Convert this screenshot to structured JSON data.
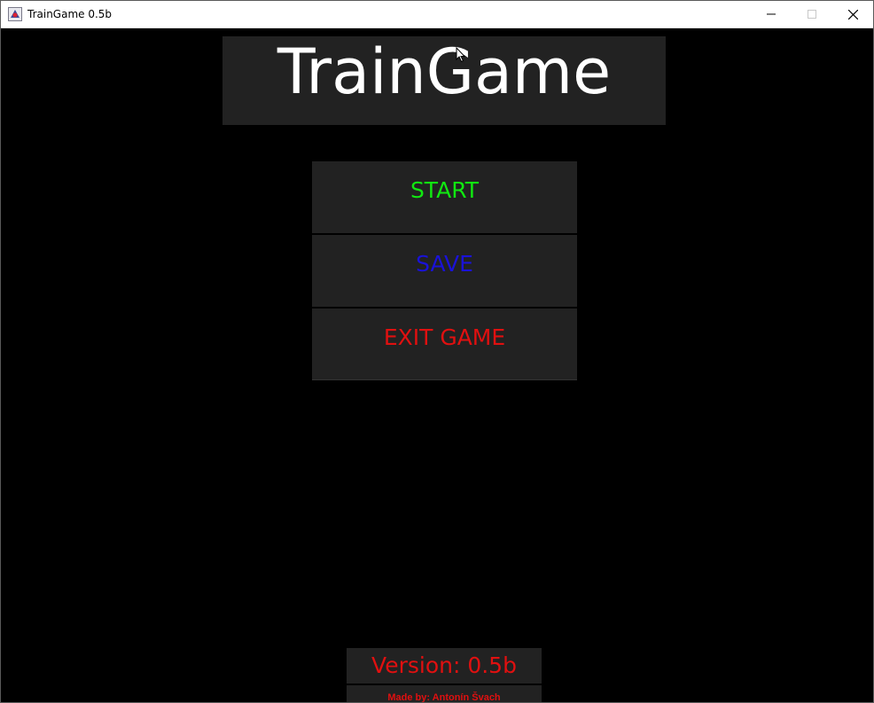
{
  "window": {
    "title": "TrainGame 0.5b",
    "icon": "java-app-icon",
    "controls": {
      "minimize_icon": "minimize-icon",
      "maximize_icon": "maximize-icon",
      "close_icon": "close-icon"
    }
  },
  "header": {
    "title": "TrainGame",
    "color": "#ffffff"
  },
  "menu": {
    "items": [
      {
        "label": "START",
        "color": "#11e811"
      },
      {
        "label": "SAVE",
        "color": "#1a12d8"
      },
      {
        "label": "EXIT GAME",
        "color": "#e01010"
      }
    ]
  },
  "footer": {
    "version": "Version: 0.5b",
    "version_color": "#e01010",
    "author": "Made by: Antonín Švach",
    "author_color": "#e01010"
  },
  "colors": {
    "background": "#000000",
    "panel": "#222222"
  }
}
